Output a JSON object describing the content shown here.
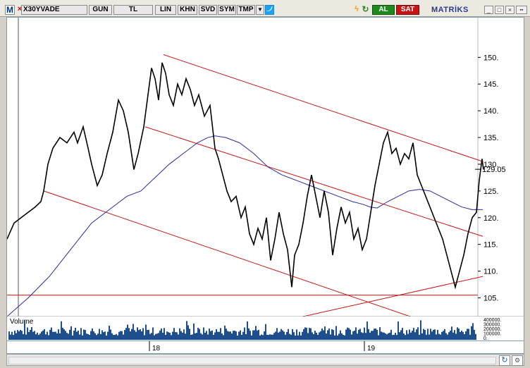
{
  "toolbar": {
    "logo_letter": "M",
    "symbol": "X30YVADE",
    "period": "GUN",
    "currency": "TL",
    "scale_lin": "LIN",
    "btn_khn": "KHN",
    "btn_svd": "SVD",
    "btn_sym": "SYM",
    "btn_tmp": "TMP",
    "buy_label": "AL",
    "sell_label": "SAT",
    "brand": "MATRİKS",
    "colors": {
      "buy": "#1e8a1e",
      "sell": "#c81414",
      "twitter": "#1da1f2",
      "lightning": "#f0a000",
      "refresh": "#2a8a2a"
    }
  },
  "chart_data": {
    "type": "line",
    "y_ticks": [
      "150.",
      "145.",
      "140.",
      "135.",
      "130.",
      "125.",
      "120.",
      "115.",
      "110.",
      "105."
    ],
    "y_tick_values": [
      150,
      145,
      140,
      135,
      130,
      125,
      120,
      115,
      110,
      105
    ],
    "ylim": [
      101.5,
      154
    ],
    "last_price_label": "129.05",
    "last_price": 129.05,
    "x_labels": [
      "18",
      "19"
    ],
    "volume_label": "Volume",
    "volume_ticks": [
      "400000.",
      "300000.",
      "200000.",
      "100000.",
      "0."
    ],
    "price_path": [
      [
        0,
        116
      ],
      [
        10,
        119
      ],
      [
        20,
        120
      ],
      [
        30,
        121
      ],
      [
        40,
        122
      ],
      [
        48,
        123
      ],
      [
        52,
        125
      ],
      [
        58,
        130
      ],
      [
        65,
        133
      ],
      [
        75,
        135
      ],
      [
        85,
        134
      ],
      [
        95,
        136
      ],
      [
        100,
        134
      ],
      [
        108,
        137
      ],
      [
        115,
        133
      ],
      [
        120,
        130
      ],
      [
        128,
        126
      ],
      [
        135,
        128
      ],
      [
        142,
        132
      ],
      [
        150,
        136
      ],
      [
        158,
        142
      ],
      [
        165,
        140
      ],
      [
        172,
        136
      ],
      [
        180,
        129
      ],
      [
        186,
        132
      ],
      [
        194,
        137
      ],
      [
        200,
        143
      ],
      [
        205,
        148
      ],
      [
        210,
        146
      ],
      [
        215,
        142
      ],
      [
        220,
        149
      ],
      [
        225,
        147
      ],
      [
        230,
        143
      ],
      [
        236,
        141
      ],
      [
        242,
        145
      ],
      [
        248,
        143
      ],
      [
        254,
        146
      ],
      [
        260,
        144
      ],
      [
        266,
        141
      ],
      [
        272,
        143
      ],
      [
        280,
        139
      ],
      [
        288,
        141
      ],
      [
        295,
        133
      ],
      [
        300,
        131
      ],
      [
        306,
        128
      ],
      [
        312,
        125
      ],
      [
        318,
        123
      ],
      [
        325,
        124
      ],
      [
        332,
        120
      ],
      [
        338,
        122
      ],
      [
        344,
        117
      ],
      [
        350,
        115
      ],
      [
        356,
        118
      ],
      [
        362,
        116
      ],
      [
        368,
        120
      ],
      [
        374,
        112
      ],
      [
        380,
        116
      ],
      [
        386,
        121
      ],
      [
        392,
        117
      ],
      [
        398,
        114
      ],
      [
        404,
        107
      ],
      [
        408,
        113
      ],
      [
        414,
        115
      ],
      [
        420,
        119
      ],
      [
        426,
        124
      ],
      [
        432,
        128
      ],
      [
        438,
        124
      ],
      [
        444,
        120
      ],
      [
        450,
        125
      ],
      [
        456,
        121
      ],
      [
        462,
        113
      ],
      [
        468,
        118
      ],
      [
        474,
        122
      ],
      [
        480,
        119
      ],
      [
        486,
        121
      ],
      [
        492,
        116
      ],
      [
        498,
        118
      ],
      [
        504,
        114
      ],
      [
        510,
        116
      ],
      [
        516,
        121
      ],
      [
        522,
        126
      ],
      [
        528,
        130
      ],
      [
        534,
        134
      ],
      [
        540,
        136
      ],
      [
        546,
        132
      ],
      [
        552,
        133
      ],
      [
        558,
        130
      ],
      [
        564,
        132
      ],
      [
        570,
        131
      ],
      [
        576,
        134
      ],
      [
        582,
        128
      ],
      [
        588,
        126
      ],
      [
        594,
        124
      ],
      [
        600,
        122
      ],
      [
        606,
        120
      ],
      [
        612,
        118
      ],
      [
        618,
        116
      ],
      [
        624,
        113
      ],
      [
        630,
        110
      ],
      [
        636,
        107
      ],
      [
        642,
        110
      ],
      [
        648,
        113
      ],
      [
        654,
        117
      ],
      [
        660,
        120
      ],
      [
        666,
        121
      ],
      [
        670,
        127
      ],
      [
        674,
        131
      ],
      [
        676,
        129
      ]
    ],
    "ma_path": [
      [
        0,
        101.5
      ],
      [
        30,
        105
      ],
      [
        60,
        109
      ],
      [
        90,
        114
      ],
      [
        120,
        119
      ],
      [
        150,
        122
      ],
      [
        170,
        124
      ],
      [
        190,
        125
      ],
      [
        210,
        127.5
      ],
      [
        230,
        130
      ],
      [
        250,
        132
      ],
      [
        270,
        134
      ],
      [
        285,
        135
      ],
      [
        295,
        135.3
      ],
      [
        310,
        135
      ],
      [
        330,
        134
      ],
      [
        350,
        132
      ],
      [
        370,
        129.5
      ],
      [
        390,
        128
      ],
      [
        410,
        127
      ],
      [
        430,
        126
      ],
      [
        450,
        125
      ],
      [
        470,
        124
      ],
      [
        490,
        123
      ],
      [
        505,
        122.5
      ],
      [
        515,
        122
      ],
      [
        525,
        121.8
      ],
      [
        540,
        123
      ],
      [
        555,
        124
      ],
      [
        570,
        125
      ],
      [
        585,
        125.3
      ],
      [
        600,
        125
      ],
      [
        615,
        124
      ],
      [
        630,
        123
      ],
      [
        645,
        122
      ],
      [
        660,
        121.5
      ],
      [
        675,
        121.5
      ]
    ],
    "channel_lines": [
      [
        [
          222,
          150.5
        ],
        [
          675,
          130.5
        ]
      ],
      [
        [
          196,
          137
        ],
        [
          675,
          116.5
        ]
      ],
      [
        [
          52,
          125
        ],
        [
          572,
          101.5
        ]
      ],
      [
        [
          420,
          101.5
        ],
        [
          675,
          109
        ]
      ]
    ],
    "horizontal_line": 105.5
  },
  "statusbar": {
    "refresh_icon": "refresh-icon"
  }
}
